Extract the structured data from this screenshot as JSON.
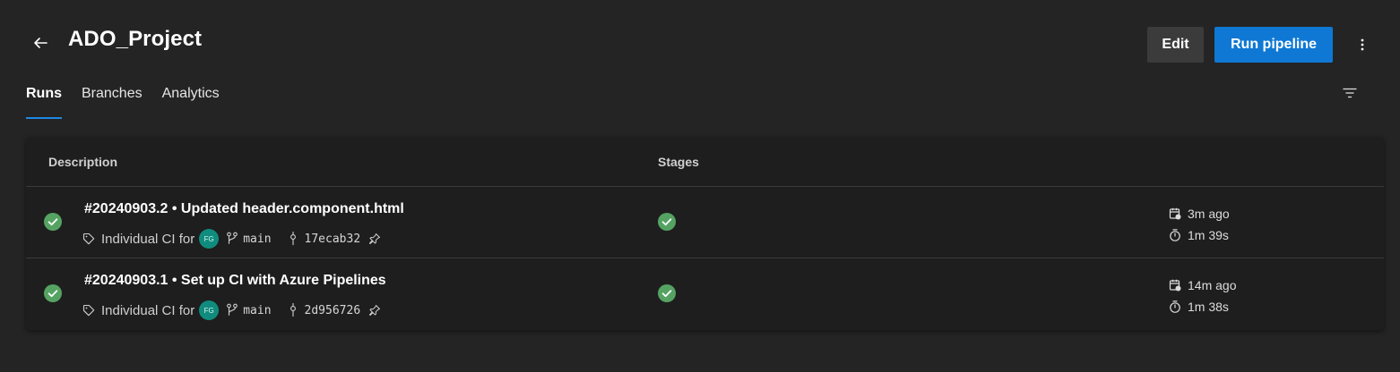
{
  "header": {
    "title": "ADO_Project",
    "edit_label": "Edit",
    "run_label": "Run pipeline"
  },
  "tabs": [
    {
      "label": "Runs",
      "active": true
    },
    {
      "label": "Branches",
      "active": false
    },
    {
      "label": "Analytics",
      "active": false
    }
  ],
  "table": {
    "columns": {
      "description": "Description",
      "stages": "Stages"
    },
    "rows": [
      {
        "title": "#20240903.2 • Updated header.component.html",
        "trigger": "Individual CI for",
        "avatar": "FG",
        "branch": "main",
        "commit": "17ecab32",
        "status": "succeeded",
        "stage_status": "succeeded",
        "queued": "3m ago",
        "duration": "1m 39s"
      },
      {
        "title": "#20240903.1 • Set up CI with Azure Pipelines",
        "trigger": "Individual CI for",
        "avatar": "FG",
        "branch": "main",
        "commit": "2d956726",
        "status": "succeeded",
        "stage_status": "succeeded",
        "queued": "14m ago",
        "duration": "1m 38s"
      }
    ]
  },
  "colors": {
    "background": "#242424",
    "card": "#1e1e1e",
    "accent": "#0f78d4",
    "success": "#55a362",
    "avatar": "#108c7e"
  },
  "icons": [
    "back-arrow-icon",
    "more-vertical-icon",
    "filter-icon",
    "success-check-icon",
    "tag-icon",
    "branch-icon",
    "commit-icon",
    "pin-icon",
    "calendar-icon",
    "stopwatch-icon"
  ]
}
